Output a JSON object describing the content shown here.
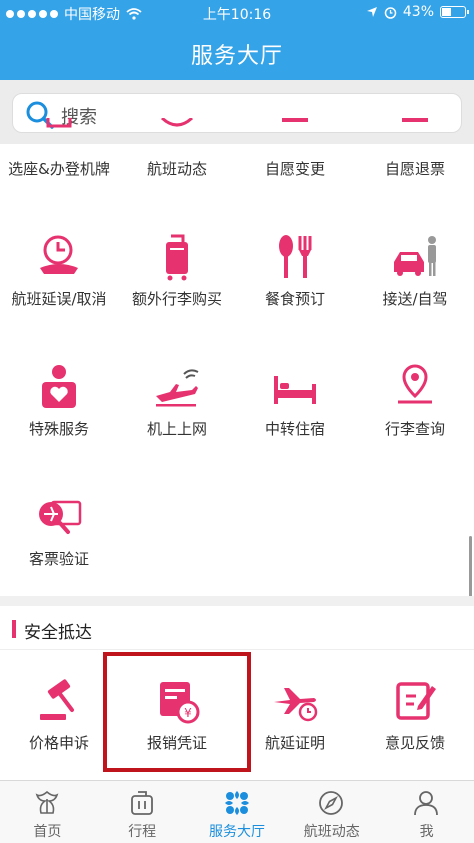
{
  "status_bar": {
    "carrier": "中国移动",
    "time": "上午10:16",
    "battery": "43%",
    "battery_level": 0.43
  },
  "header": {
    "title": "服务大厅"
  },
  "search": {
    "placeholder": "搜索"
  },
  "services_row0": [
    "选座&办登机牌",
    "航班动态",
    "自愿变更",
    "自愿退票"
  ],
  "services": [
    {
      "label": "航班延误/取消",
      "icon": "delay-clock-icon"
    },
    {
      "label": "额外行李购买",
      "icon": "luggage-icon"
    },
    {
      "label": "餐食预订",
      "icon": "meal-icon"
    },
    {
      "label": "接送/自驾",
      "icon": "car-person-icon"
    },
    {
      "label": "特殊服务",
      "icon": "special-service-icon"
    },
    {
      "label": "机上上网",
      "icon": "wifi-plane-icon"
    },
    {
      "label": "中转住宿",
      "icon": "bed-icon"
    },
    {
      "label": "行李查询",
      "icon": "location-pin-icon"
    },
    {
      "label": "客票验证",
      "icon": "ticket-verify-icon"
    }
  ],
  "safe_section": {
    "title": "安全抵达",
    "items": [
      {
        "label": "价格申诉",
        "icon": "gavel-icon"
      },
      {
        "label": "报销凭证",
        "icon": "receipt-yuan-icon"
      },
      {
        "label": "航延证明",
        "icon": "plane-delay-icon"
      },
      {
        "label": "意见反馈",
        "icon": "feedback-edit-icon"
      }
    ]
  },
  "tabs": [
    {
      "label": "首页",
      "icon": "home-logo-icon"
    },
    {
      "label": "行程",
      "icon": "itinerary-icon"
    },
    {
      "label": "服务大厅",
      "icon": "service-hall-icon"
    },
    {
      "label": "航班动态",
      "icon": "compass-icon"
    },
    {
      "label": "我",
      "icon": "user-icon"
    }
  ],
  "active_tab": 2,
  "colors": {
    "brand_blue": "#34a3e8",
    "accent_pink": "#e6326e",
    "tab_active": "#1b8fdd",
    "highlight_red": "#c0141c"
  }
}
